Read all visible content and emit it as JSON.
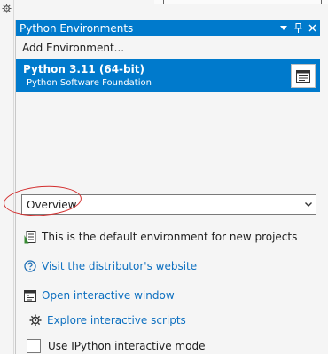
{
  "panel": {
    "title": "Python Environments",
    "pin_glyph": "⊣",
    "dropdown_glyph": "▾",
    "close_glyph": "✕"
  },
  "toolbar": {
    "add_environment_label": "Add Environment..."
  },
  "environments": [
    {
      "name": "Python 3.11 (64-bit)",
      "vendor": "Python Software Foundation",
      "selected": true
    }
  ],
  "view_selector": {
    "selected": "Overview"
  },
  "overview": {
    "default_env_text": "This is the default environment for new projects",
    "distributor_link": "Visit the distributor's website",
    "interactive_window_link": "Open interactive window",
    "interactive_scripts_link": "Explore interactive scripts",
    "ipython_mode_label": "Use IPython interactive mode",
    "ipython_mode_checked": false
  },
  "colors": {
    "accent": "#007acc",
    "link": "#0e70c0",
    "annotation": "#d32f2f"
  },
  "icons": {
    "gutter": "gear-icon",
    "env_overview": "overview-icon",
    "default_env": "default-environment-icon",
    "distributor": "help-icon",
    "interactive_window": "interactive-window-icon",
    "interactive_scripts": "gear-icon",
    "dropdown": "chevron-down-icon"
  }
}
